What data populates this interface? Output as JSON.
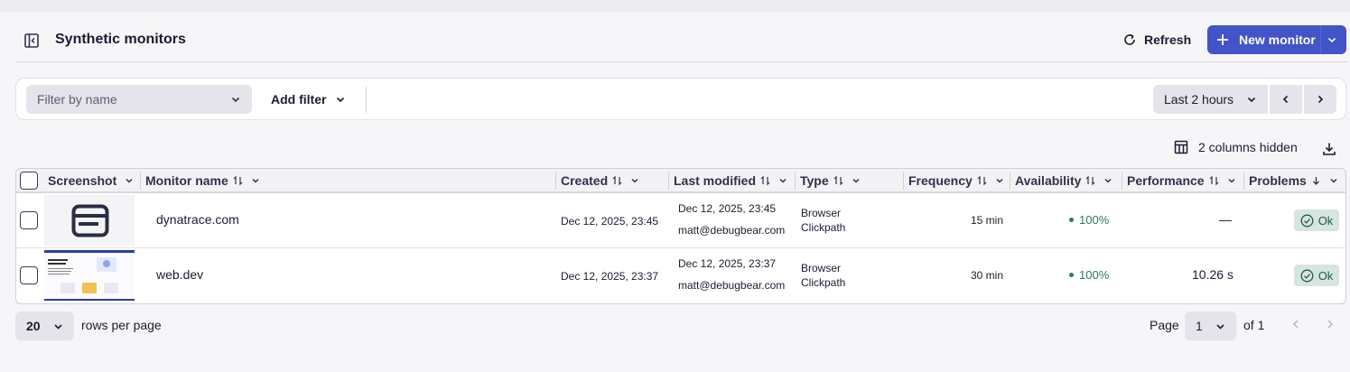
{
  "header": {
    "title": "Synthetic monitors",
    "refresh_label": "Refresh",
    "new_monitor_label": "New monitor"
  },
  "filters": {
    "filter_placeholder": "Filter by name",
    "add_filter_label": "Add filter",
    "timeframe": "Last 2 hours"
  },
  "toolbar": {
    "columns_hidden": "2 columns hidden"
  },
  "table": {
    "columns": [
      "Screenshot",
      "Monitor name",
      "Created",
      "Last modified",
      "Type",
      "Frequency",
      "Availability",
      "Performance",
      "Problems"
    ],
    "rows": [
      {
        "name": "dynatrace.com",
        "created": "Dec 12, 2025, 23:45",
        "modified_date": "Dec 12, 2025, 23:45",
        "modified_by": "matt@debugbear.com",
        "type_line1": "Browser",
        "type_line2": "Clickpath",
        "frequency": "15 min",
        "availability": "100%",
        "performance": "—",
        "problems": "Ok"
      },
      {
        "name": "web.dev",
        "created": "Dec 12, 2025, 23:37",
        "modified_date": "Dec 12, 2025, 23:37",
        "modified_by": "matt@debugbear.com",
        "type_line1": "Browser",
        "type_line2": "Clickpath",
        "frequency": "30 min",
        "availability": "100%",
        "performance": "10.26 s",
        "problems": "Ok"
      }
    ]
  },
  "pagination": {
    "rows_per_page_value": "20",
    "rows_per_page_label": "rows per page",
    "page_label": "Page",
    "page_value": "1",
    "of_label": "of 1"
  },
  "colors": {
    "primary": "#4353c8",
    "ok_bg": "#d7e5e0",
    "availability": "#2a7a62"
  }
}
